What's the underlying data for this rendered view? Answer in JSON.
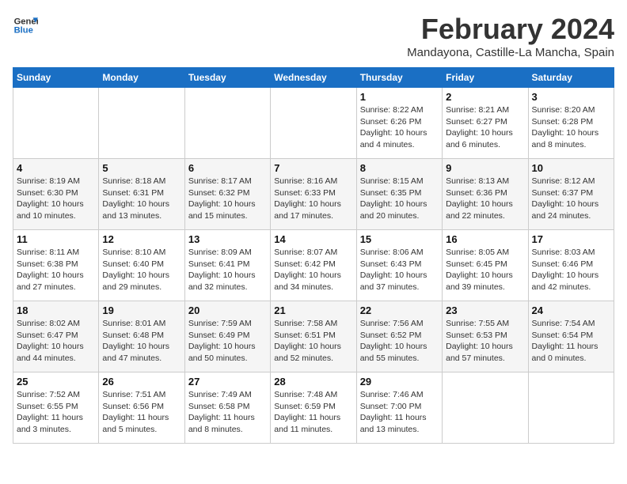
{
  "header": {
    "logo_line1": "General",
    "logo_line2": "Blue",
    "title": "February 2024",
    "subtitle": "Mandayona, Castille-La Mancha, Spain"
  },
  "weekdays": [
    "Sunday",
    "Monday",
    "Tuesday",
    "Wednesday",
    "Thursday",
    "Friday",
    "Saturday"
  ],
  "weeks": [
    [
      {
        "day": "",
        "info": ""
      },
      {
        "day": "",
        "info": ""
      },
      {
        "day": "",
        "info": ""
      },
      {
        "day": "",
        "info": ""
      },
      {
        "day": "1",
        "info": "Sunrise: 8:22 AM\nSunset: 6:26 PM\nDaylight: 10 hours\nand 4 minutes."
      },
      {
        "day": "2",
        "info": "Sunrise: 8:21 AM\nSunset: 6:27 PM\nDaylight: 10 hours\nand 6 minutes."
      },
      {
        "day": "3",
        "info": "Sunrise: 8:20 AM\nSunset: 6:28 PM\nDaylight: 10 hours\nand 8 minutes."
      }
    ],
    [
      {
        "day": "4",
        "info": "Sunrise: 8:19 AM\nSunset: 6:30 PM\nDaylight: 10 hours\nand 10 minutes."
      },
      {
        "day": "5",
        "info": "Sunrise: 8:18 AM\nSunset: 6:31 PM\nDaylight: 10 hours\nand 13 minutes."
      },
      {
        "day": "6",
        "info": "Sunrise: 8:17 AM\nSunset: 6:32 PM\nDaylight: 10 hours\nand 15 minutes."
      },
      {
        "day": "7",
        "info": "Sunrise: 8:16 AM\nSunset: 6:33 PM\nDaylight: 10 hours\nand 17 minutes."
      },
      {
        "day": "8",
        "info": "Sunrise: 8:15 AM\nSunset: 6:35 PM\nDaylight: 10 hours\nand 20 minutes."
      },
      {
        "day": "9",
        "info": "Sunrise: 8:13 AM\nSunset: 6:36 PM\nDaylight: 10 hours\nand 22 minutes."
      },
      {
        "day": "10",
        "info": "Sunrise: 8:12 AM\nSunset: 6:37 PM\nDaylight: 10 hours\nand 24 minutes."
      }
    ],
    [
      {
        "day": "11",
        "info": "Sunrise: 8:11 AM\nSunset: 6:38 PM\nDaylight: 10 hours\nand 27 minutes."
      },
      {
        "day": "12",
        "info": "Sunrise: 8:10 AM\nSunset: 6:40 PM\nDaylight: 10 hours\nand 29 minutes."
      },
      {
        "day": "13",
        "info": "Sunrise: 8:09 AM\nSunset: 6:41 PM\nDaylight: 10 hours\nand 32 minutes."
      },
      {
        "day": "14",
        "info": "Sunrise: 8:07 AM\nSunset: 6:42 PM\nDaylight: 10 hours\nand 34 minutes."
      },
      {
        "day": "15",
        "info": "Sunrise: 8:06 AM\nSunset: 6:43 PM\nDaylight: 10 hours\nand 37 minutes."
      },
      {
        "day": "16",
        "info": "Sunrise: 8:05 AM\nSunset: 6:45 PM\nDaylight: 10 hours\nand 39 minutes."
      },
      {
        "day": "17",
        "info": "Sunrise: 8:03 AM\nSunset: 6:46 PM\nDaylight: 10 hours\nand 42 minutes."
      }
    ],
    [
      {
        "day": "18",
        "info": "Sunrise: 8:02 AM\nSunset: 6:47 PM\nDaylight: 10 hours\nand 44 minutes."
      },
      {
        "day": "19",
        "info": "Sunrise: 8:01 AM\nSunset: 6:48 PM\nDaylight: 10 hours\nand 47 minutes."
      },
      {
        "day": "20",
        "info": "Sunrise: 7:59 AM\nSunset: 6:49 PM\nDaylight: 10 hours\nand 50 minutes."
      },
      {
        "day": "21",
        "info": "Sunrise: 7:58 AM\nSunset: 6:51 PM\nDaylight: 10 hours\nand 52 minutes."
      },
      {
        "day": "22",
        "info": "Sunrise: 7:56 AM\nSunset: 6:52 PM\nDaylight: 10 hours\nand 55 minutes."
      },
      {
        "day": "23",
        "info": "Sunrise: 7:55 AM\nSunset: 6:53 PM\nDaylight: 10 hours\nand 57 minutes."
      },
      {
        "day": "24",
        "info": "Sunrise: 7:54 AM\nSunset: 6:54 PM\nDaylight: 11 hours\nand 0 minutes."
      }
    ],
    [
      {
        "day": "25",
        "info": "Sunrise: 7:52 AM\nSunset: 6:55 PM\nDaylight: 11 hours\nand 3 minutes."
      },
      {
        "day": "26",
        "info": "Sunrise: 7:51 AM\nSunset: 6:56 PM\nDaylight: 11 hours\nand 5 minutes."
      },
      {
        "day": "27",
        "info": "Sunrise: 7:49 AM\nSunset: 6:58 PM\nDaylight: 11 hours\nand 8 minutes."
      },
      {
        "day": "28",
        "info": "Sunrise: 7:48 AM\nSunset: 6:59 PM\nDaylight: 11 hours\nand 11 minutes."
      },
      {
        "day": "29",
        "info": "Sunrise: 7:46 AM\nSunset: 7:00 PM\nDaylight: 11 hours\nand 13 minutes."
      },
      {
        "day": "",
        "info": ""
      },
      {
        "day": "",
        "info": ""
      }
    ]
  ]
}
